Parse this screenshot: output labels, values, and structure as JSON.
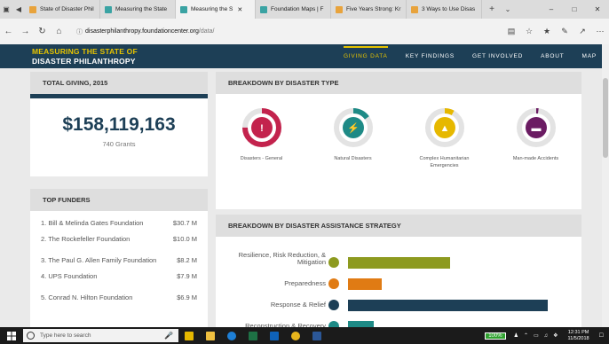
{
  "browser": {
    "tabs": [
      {
        "label": "State of Disaster Phil",
        "color": "#e8a33c"
      },
      {
        "label": "Measuring the State",
        "color": "#3aa3a3"
      },
      {
        "label": "Measuring the S",
        "color": "#3aa3a3",
        "active": true
      },
      {
        "label": "Foundation Maps | F",
        "color": "#3aa3a3"
      },
      {
        "label": "Five Years Strong: Kr",
        "color": "#e8a33c"
      },
      {
        "label": "3 Ways to Use Disas",
        "color": "#e8a33c"
      }
    ],
    "url_host": "disasterphilanthropy.foundationcenter.org",
    "url_path": "/data/"
  },
  "site": {
    "logo_line1": "MEASURING THE STATE OF",
    "logo_line2": "DISASTER PHILANTHROPY",
    "menu": [
      "GIVING DATA",
      "KEY FINDINGS",
      "GET INVOLVED",
      "ABOUT",
      "MAP"
    ]
  },
  "total": {
    "title": "TOTAL GIVING, 2015",
    "amount": "$158,119,163",
    "grants": "740 Grants"
  },
  "breakdown_type": {
    "title": "BREAKDOWN BY DISASTER TYPE",
    "items": [
      {
        "label": "Disasters - General",
        "color": "#c3234d",
        "fraction": 0.75,
        "icon": "exclamation-icon"
      },
      {
        "label": "Natural Disasters",
        "color": "#1e8a86",
        "fraction": 0.15,
        "icon": "storm-cloud-icon"
      },
      {
        "label": "Complex Humanitarian Emergencies",
        "color": "#e6b800",
        "fraction": 0.08,
        "icon": "tent-icon"
      },
      {
        "label": "Man-made Accidents",
        "color": "#6b1c63",
        "fraction": 0.02,
        "icon": "ship-icon"
      }
    ]
  },
  "funders": {
    "title": "TOP FUNDERS",
    "rows": [
      {
        "name": "1. Bill & Melinda Gates Foundation",
        "amount": "$30.7 M"
      },
      {
        "name": "2. The Rockefeller Foundation",
        "amount": "$10.0 M"
      },
      {
        "name": "3. The Paul G. Allen Family Foundation",
        "amount": "$8.2 M"
      },
      {
        "name": "4. UPS Foundation",
        "amount": "$7.9 M"
      },
      {
        "name": "5. Conrad N. Hilton Foundation",
        "amount": "$6.9 M"
      }
    ]
  },
  "strategy": {
    "title": "BREAKDOWN BY DISASTER ASSISTANCE STRATEGY",
    "rows": [
      {
        "label": "Resilience, Risk Reduction, & Mitigation",
        "color": "#8d9a1f",
        "fraction": 0.51,
        "icon_color": "#8d9a1f"
      },
      {
        "label": "Preparedness",
        "color": "#e07b14",
        "fraction": 0.17,
        "icon_color": "#e07b14"
      },
      {
        "label": "Response & Relief",
        "color": "#1d3f56",
        "fraction": 1.0,
        "icon_color": "#1d3f56"
      },
      {
        "label": "Reconstruction & Recovery",
        "color": "#1e8a86",
        "fraction": 0.13,
        "icon_color": "#1e8a86"
      }
    ]
  },
  "taskbar": {
    "search_placeholder": "Type here to search",
    "battery": "100%",
    "time": "12:31 PM",
    "date": "11/5/2018"
  }
}
